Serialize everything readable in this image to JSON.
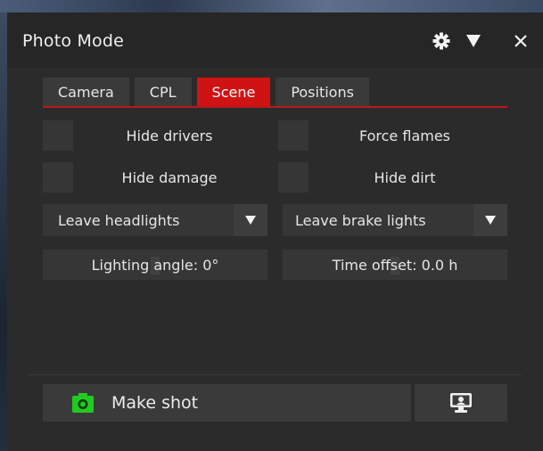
{
  "window": {
    "title": "Photo Mode",
    "buttons": {
      "settings_icon": "gear-icon",
      "collapse_icon": "triangle-down-icon",
      "close_icon": "close-icon"
    }
  },
  "tabs": [
    {
      "label": "Camera",
      "active": false
    },
    {
      "label": "CPL",
      "active": false
    },
    {
      "label": "Scene",
      "active": true
    },
    {
      "label": "Positions",
      "active": false
    }
  ],
  "scene": {
    "checkboxes": [
      {
        "label": "Hide drivers",
        "checked": false
      },
      {
        "label": "Force flames",
        "checked": false
      },
      {
        "label": "Hide damage",
        "checked": false
      },
      {
        "label": "Hide dirt",
        "checked": false
      }
    ],
    "dropdowns": [
      {
        "value": "Leave headlights"
      },
      {
        "value": "Leave brake lights"
      }
    ],
    "sliders": [
      {
        "label": "Lighting angle: 0°",
        "value": 0
      },
      {
        "label": "Time offset: 0.0 h",
        "value": 0.0
      }
    ]
  },
  "footer": {
    "make_shot_label": "Make shot",
    "make_shot_icon": "camera-icon",
    "screen_icon": "monitor-icon"
  },
  "colors": {
    "accent": "#cf1313",
    "camera_icon": "#22c922",
    "panel_bg": "#2b2b2b",
    "control_bg": "#363636"
  }
}
